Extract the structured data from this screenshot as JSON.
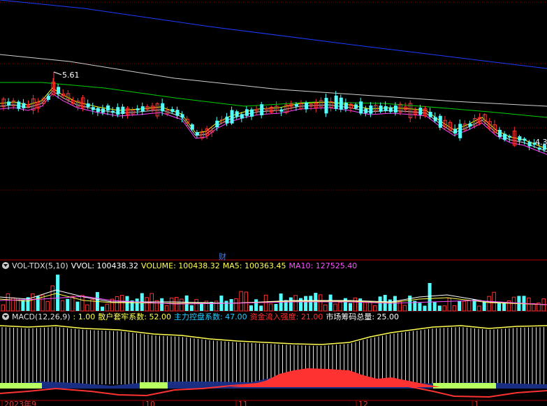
{
  "main": {
    "high_label": "5.61",
    "right_partial_label": "4.3",
    "cai_marker": "财"
  },
  "vol_panel": {
    "name": "VOL-TDX(5,10)",
    "vvol": "VVOL: 100438.32",
    "volume": "VOLUME: 100438.32",
    "ma5": "MA5: 100363.45",
    "ma10": "MA10: 127525.40"
  },
  "macd_panel": {
    "name": "MACD(12,26,9)",
    "v1": ": 1.00",
    "sanhu": "散户套牢系数: 52.00",
    "zhuli": "主力控盘系数: 47.00",
    "zijin": "资金流入强度: 21.00",
    "shichang": "市场筹码总量: 25.00"
  },
  "xaxis": {
    "labels": [
      "2023年9",
      "10",
      "11",
      "12",
      "1"
    ]
  },
  "colors": {
    "up": "#ff3232",
    "down": "#54ffff",
    "ma_white": "#d0d0d0",
    "ma_yellow": "#ffff00",
    "ma_magenta": "#ff40ff",
    "ma_green": "#00d000",
    "ma_blue": "#1a3cff",
    "grid": "#8b0000",
    "panel_border": "#b00000",
    "vol_white": "#ffffff",
    "vol_yellow": "#ffff50",
    "vol_magenta": "#ff50ff",
    "zijin": "#ff3232",
    "zhuli": "#22ccff",
    "sanhu": "#ffff50",
    "shichang": "#ffffff"
  }
}
